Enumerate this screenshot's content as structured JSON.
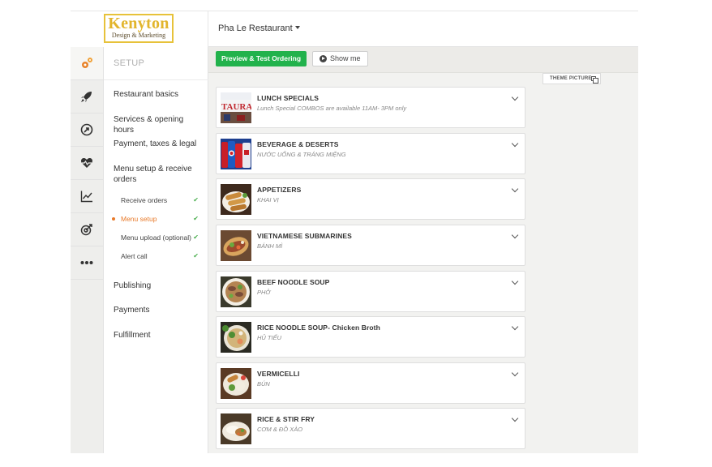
{
  "logo": {
    "brand": "Kenyton",
    "tagline": "Design & Marketing"
  },
  "header": {
    "restaurant": "Pha Le Restaurant"
  },
  "rail": {
    "icons": [
      "gears-icon",
      "rocket-icon",
      "circle-arrow-icon",
      "heart-pulse-icon",
      "line-chart-icon",
      "target-icon",
      "more-dots-icon"
    ]
  },
  "nav": {
    "title": "SETUP",
    "items": [
      {
        "label": "Restaurant basics"
      },
      {
        "label": "Services & opening hours"
      },
      {
        "label": "Payment, taxes & legal"
      },
      {
        "label": "Menu setup & receive orders"
      }
    ],
    "subitems": [
      {
        "label": "Receive orders",
        "check": "✔"
      },
      {
        "label": "Menu setup",
        "check": "✔"
      },
      {
        "label": "Menu upload (optional)",
        "check": "✔"
      },
      {
        "label": "Alert call",
        "check": "✔"
      }
    ],
    "bottom_items": [
      {
        "label": "Publishing"
      },
      {
        "label": "Payments"
      },
      {
        "label": "Fulfillment"
      }
    ]
  },
  "toolbar": {
    "preview_label": "Preview & Test Ordering",
    "show_label": "Show me"
  },
  "theme": {
    "label": "THEME PICTURE"
  },
  "categories": [
    {
      "name": "LUNCH SPECIALS",
      "desc": "Lunch Special COMBOS are available 11AM- 3PM only"
    },
    {
      "name": "BEVERAGE & DESERTS",
      "desc": "NƯỚC UỐNG & TRÁNG MIỆNG"
    },
    {
      "name": "APPETIZERS",
      "desc": "KHAI VỊ"
    },
    {
      "name": "VIETNAMESE SUBMARINES",
      "desc": "BÁNH MÌ"
    },
    {
      "name": "BEEF NOODLE SOUP",
      "desc": "PHỞ"
    },
    {
      "name": "RICE NOODLE SOUP- Chicken Broth",
      "desc": "HỦ TIẾU"
    },
    {
      "name": "VERMICELLI",
      "desc": "BÚN"
    },
    {
      "name": "RICE & STIR FRY",
      "desc": "CƠM & ĐỒ XÀO"
    }
  ],
  "thumb_text": {
    "lunch": "TAURAN"
  },
  "colors": {
    "accent": "#22b24c",
    "active": "#e87a2a",
    "logo": "#e2b52c"
  }
}
